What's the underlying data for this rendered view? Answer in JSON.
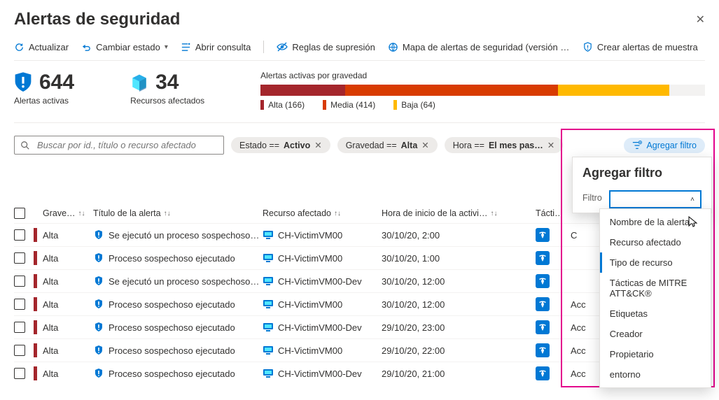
{
  "header": {
    "title": "Alertas de seguridad"
  },
  "toolbar": {
    "refresh": "Actualizar",
    "change_state": "Cambiar estado",
    "open_query": "Abrir consulta",
    "suppression": "Reglas de supresión",
    "map": "Mapa de alertas de seguridad (versión preli…",
    "sample": "Crear alertas de muestra"
  },
  "summary": {
    "active_count": "644",
    "active_label": "Alertas activas",
    "resources_count": "34",
    "resources_label": "Recursos afectados",
    "severity_title": "Alertas activas por gravedad",
    "high_label": "Alta (166)",
    "med_label": "Media (414)",
    "low_label": "Baja (64)"
  },
  "search": {
    "placeholder": "Buscar por id., título o recurso afectado"
  },
  "filters": {
    "state_key": "Estado == ",
    "state_val": "Activo",
    "sev_key": "Gravedad == ",
    "sev_val": "Alta",
    "time_key": "Hora == ",
    "time_val": "El mes pas…",
    "add": "Agregar filtro"
  },
  "popover": {
    "title": "Agregar filtro",
    "field_label": "Filtro",
    "options": [
      "Nombre de la alerta",
      "Recurso afectado",
      "Tipo de recurso",
      "Tácticas de MITRE ATT&CK®",
      "Etiquetas",
      "Creador",
      "Propietario",
      "entorno"
    ]
  },
  "columns": {
    "sev": "Grave…",
    "title": "Título de la alerta",
    "res": "Recurso afectado",
    "time": "Hora de inicio de la activi…",
    "tac": "Tácti…"
  },
  "rows": [
    {
      "sev": "Alta",
      "title": "Se ejecutó un proceso sospechoso…",
      "res": "CH-VictimVM00",
      "time": "30/10/20, 2:00",
      "ext": "C"
    },
    {
      "sev": "Alta",
      "title": "Proceso sospechoso ejecutado",
      "res": "CH-VictimVM00",
      "time": "30/10/20, 1:00",
      "ext": ""
    },
    {
      "sev": "Alta",
      "title": "Se ejecutó un proceso sospechoso…",
      "res": "CH-VictimVM00-Dev",
      "time": "30/10/20, 12:00",
      "ext": ""
    },
    {
      "sev": "Alta",
      "title": "Proceso sospechoso ejecutado",
      "res": "CH-VictimVM00",
      "time": "30/10/20, 12:00",
      "ext": "Acc"
    },
    {
      "sev": "Alta",
      "title": "Proceso sospechoso ejecutado",
      "res": "CH-VictimVM00-Dev",
      "time": "29/10/20, 23:00",
      "ext": "Acc"
    },
    {
      "sev": "Alta",
      "title": "Proceso sospechoso ejecutado",
      "res": "CH-VictimVM00",
      "time": "29/10/20, 22:00",
      "ext": "Acc"
    },
    {
      "sev": "Alta",
      "title": "Proceso sospechoso ejecutado",
      "res": "CH-VictimVM00-Dev",
      "time": "29/10/20, 21:00",
      "ext": "Acc"
    }
  ]
}
